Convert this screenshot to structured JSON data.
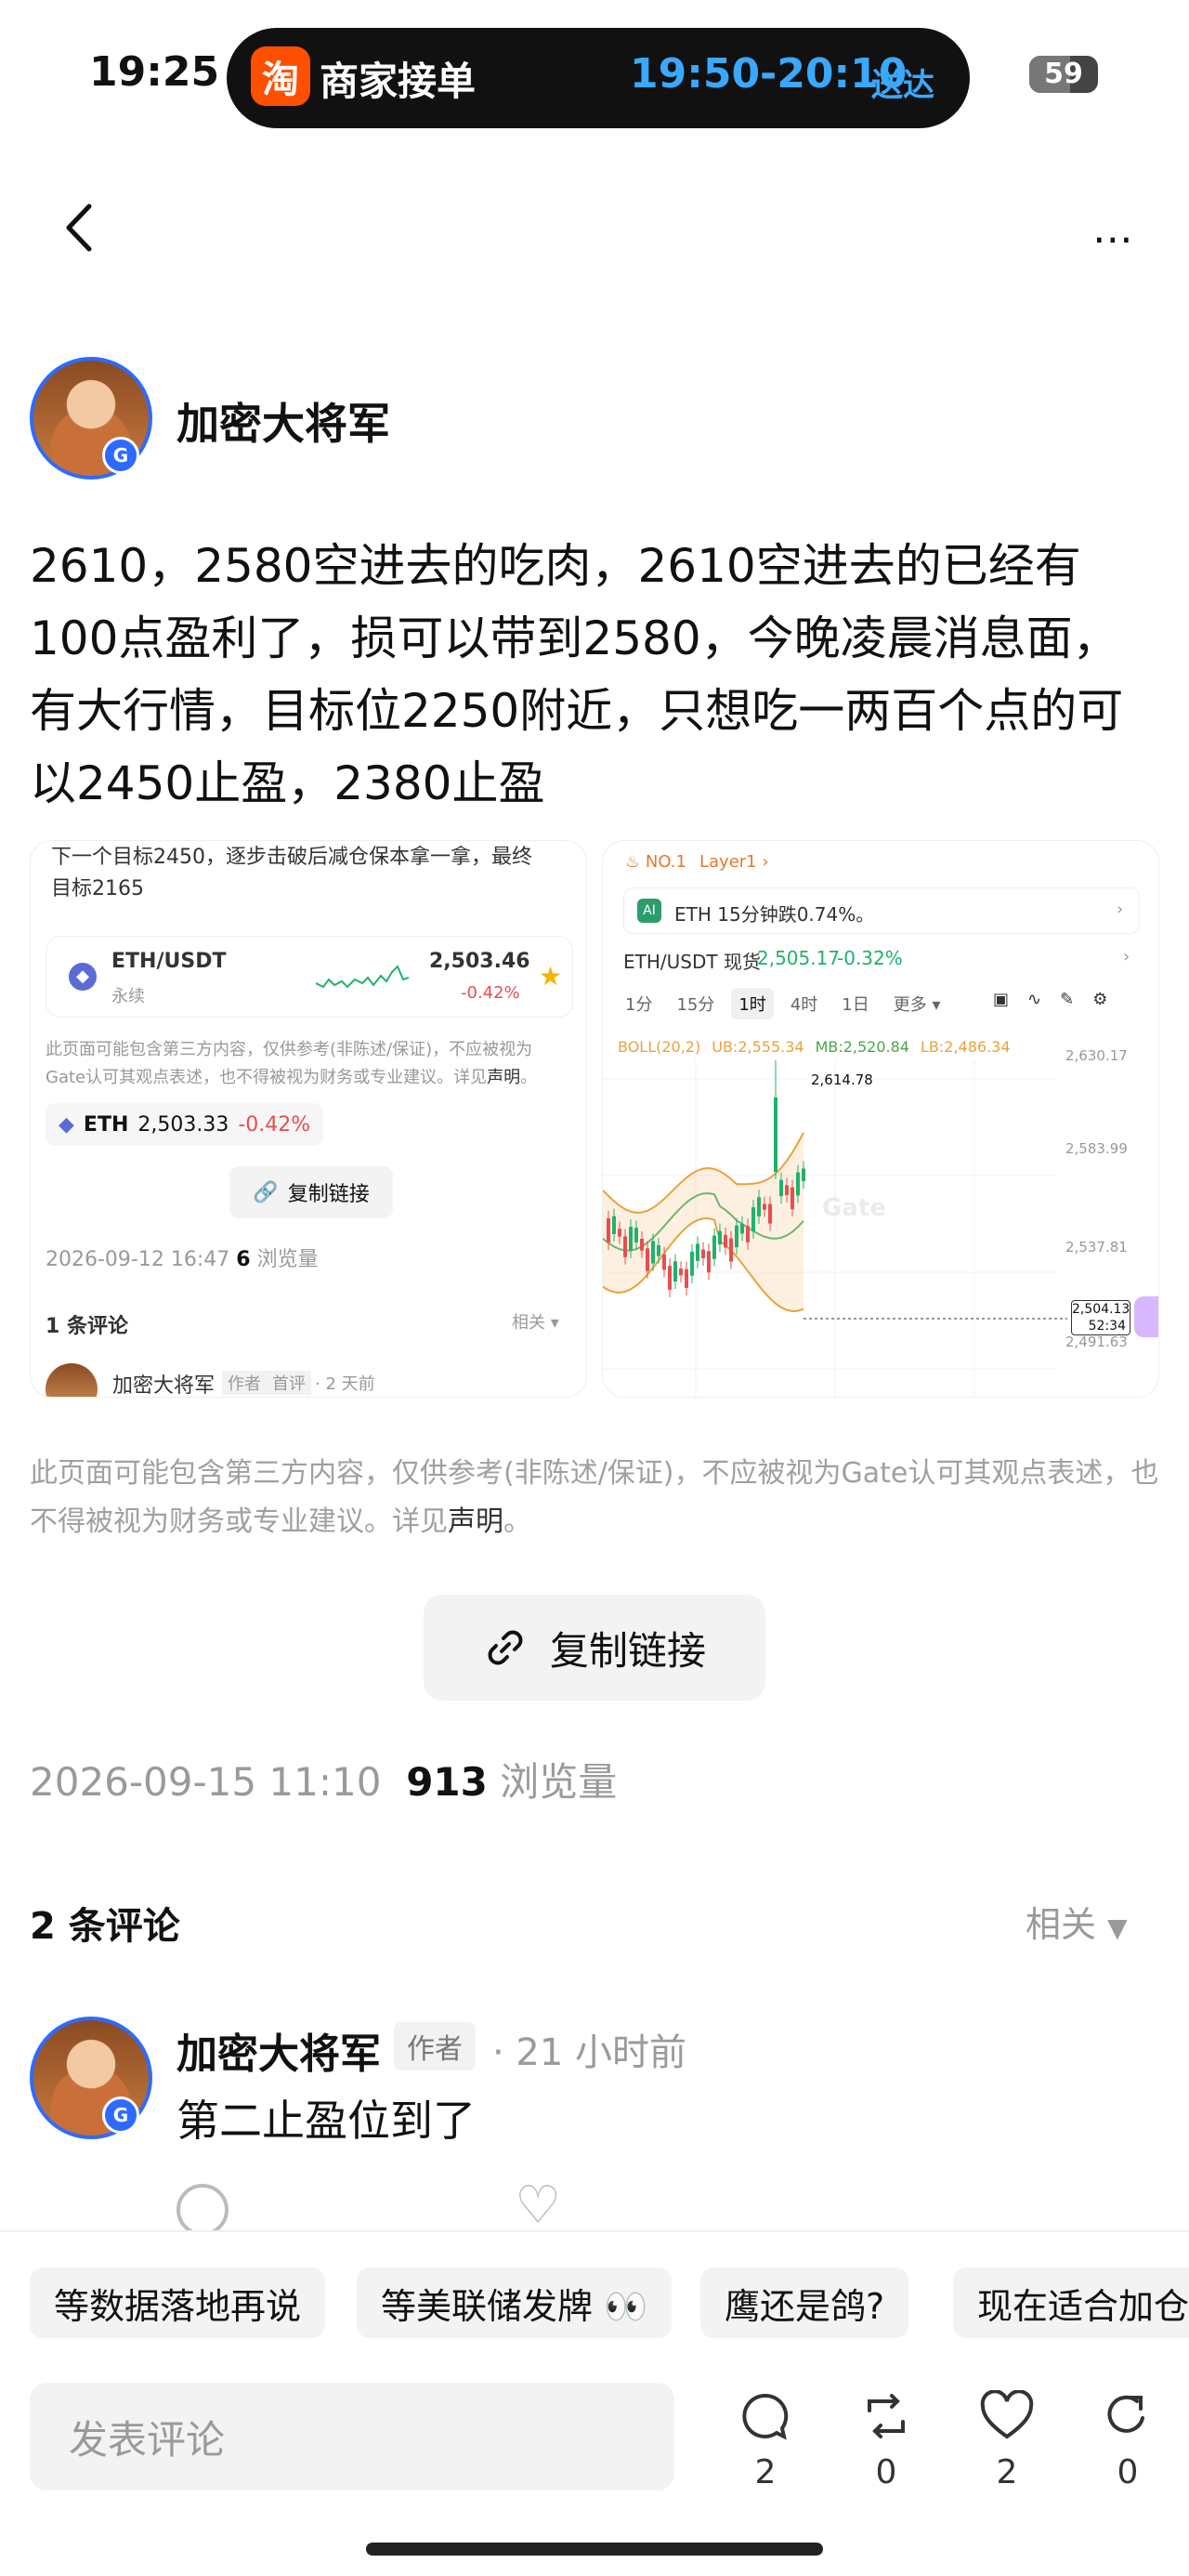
{
  "status_bar": {
    "time": "19:25",
    "app_icon": "淘",
    "app_title": "商家接单",
    "delivery_time": "19:50-20:10",
    "delivery_label": "送达",
    "battery": "59"
  },
  "post": {
    "author": "加密大将军",
    "text": "2610，2580空进去的吃肉，2610空进去的已经有100点盈利了，损可以带到2580，今晚凌晨消息面，有大行情，目标位2250附近，只想吃一两百个点的可以2450止盈，2380止盈",
    "disclaimer_prefix": "此页面可能包含第三方内容，仅供参考(非陈述/保证)，不应被视为Gate认可其观点表述，也不得被视为财务或专业建议。详见",
    "disclaimer_link": "声明",
    "disclaimer_suffix": "。",
    "copy_link": "复制链接",
    "date": "2026-09-15 11:10",
    "views": "913",
    "views_label": "浏览量"
  },
  "left_shot": {
    "top_text_1": "下一个目标2450，逐步击破后减仓保本拿一拿，最终",
    "top_text_2": "目标2165",
    "pair": "ETH/USDT",
    "pair_sub": "永续",
    "price": "2,503.46",
    "change": "-0.42%",
    "disclaimer": "此页面可能包含第三方内容，仅供参考(非陈述/保证)，不应被视为Gate认可其观点表述，也不得被视为财务或专业建议。详见",
    "disclaimer_link": "声明",
    "disclaimer_end": "。",
    "eth_tag": "ETH",
    "eth_price": "2,503.33",
    "eth_change": "-0.42%",
    "copy_link": "复制链接",
    "date": "2026-09-12 16:47",
    "views": "6",
    "views_label": "浏览量",
    "comments": "1 条评论",
    "sort": "相关",
    "commenter": "加密大将军",
    "tag_author": "作者",
    "tag_first": "首评",
    "comment_time": "· 2 天前"
  },
  "right_shot": {
    "rank": "NO.1",
    "layer": "Layer1",
    "ai_text": "ETH 15分钟跌0.74%。",
    "pair": "ETH/USDT 现货",
    "price": "2,505.17",
    "change": "-0.32%",
    "intervals": [
      "1分",
      "15分",
      "1时",
      "4时",
      "1日",
      "更多"
    ],
    "boll_label": "BOLL(20,2)",
    "ub": "UB:2,555.34",
    "mb": "MB:2,520.84",
    "lb": "LB:2,486.34",
    "high_label": "2,614.78",
    "axis": [
      "2,630.17",
      "2,583.99",
      "2,537.81",
      "2,491.63"
    ],
    "current_price": "2,504.13",
    "countdown": "52:34",
    "watermark": "Gate"
  },
  "comments": {
    "title": "2 条评论",
    "sort": "相关",
    "items": [
      {
        "name": "加密大将军",
        "tag": "作者",
        "time": "· 21 小时前",
        "text": "第二止盈位到了"
      }
    ]
  },
  "quick_replies": [
    "等数据落地再说",
    "等美联储发牌 👀",
    "鹰还是鸽?",
    "现在适合加仓"
  ],
  "composer": {
    "placeholder": "发表评论",
    "comments_count": "2",
    "repost_count": "0",
    "likes_count": "2",
    "share_count": "0"
  }
}
